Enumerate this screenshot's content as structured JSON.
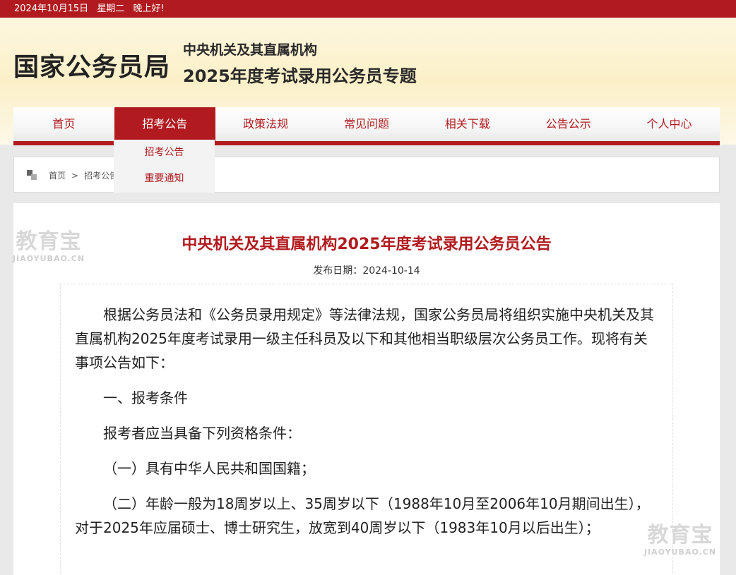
{
  "topbar": {
    "date": "2024年10月15日",
    "weekday": "星期二",
    "greeting": "晚上好!"
  },
  "header": {
    "logo": "国家公务员局",
    "subtitle1": "中央机关及其直属机构",
    "subtitle2": "2025年度考试录用公务员专题"
  },
  "nav": {
    "items": [
      {
        "label": "首页"
      },
      {
        "label": "招考公告"
      },
      {
        "label": "政策法规"
      },
      {
        "label": "常见问题"
      },
      {
        "label": "相关下载"
      },
      {
        "label": "公告公示"
      },
      {
        "label": "个人中心"
      }
    ],
    "active_index": 1,
    "dropdown": [
      {
        "label": "招考公告"
      },
      {
        "label": "重要通知"
      }
    ]
  },
  "breadcrumb": {
    "home": "首页",
    "separator": ">",
    "current": "招考公告"
  },
  "article": {
    "title": "中央机关及其直属机构2025年度考试录用公务员公告",
    "date_label": "发布日期：",
    "date": "2024-10-14",
    "paragraphs": [
      "根据公务员法和《公务员录用规定》等法律法规，国家公务员局将组织实施中央机关及其直属机构2025年度考试录用一级主任科员及以下和其他相当职级层次公务员工作。现将有关事项公告如下：",
      "一、报考条件",
      "报考者应当具备下列资格条件：",
      "（一）具有中华人民共和国国籍；",
      "（二）年龄一般为18周岁以上、35周岁以下（1988年10月至2006年10月期间出生），对于2025年应届硕士、博士研究生，放宽到40周岁以下（1983年10月以后出生）；"
    ]
  },
  "watermark": {
    "text": "教育宝",
    "domain": "JIAOYUBAO.CN"
  },
  "colors": {
    "brand_red": "#b11b1f",
    "topbar": "#b11b1f",
    "banner": "#fbf0c8"
  }
}
